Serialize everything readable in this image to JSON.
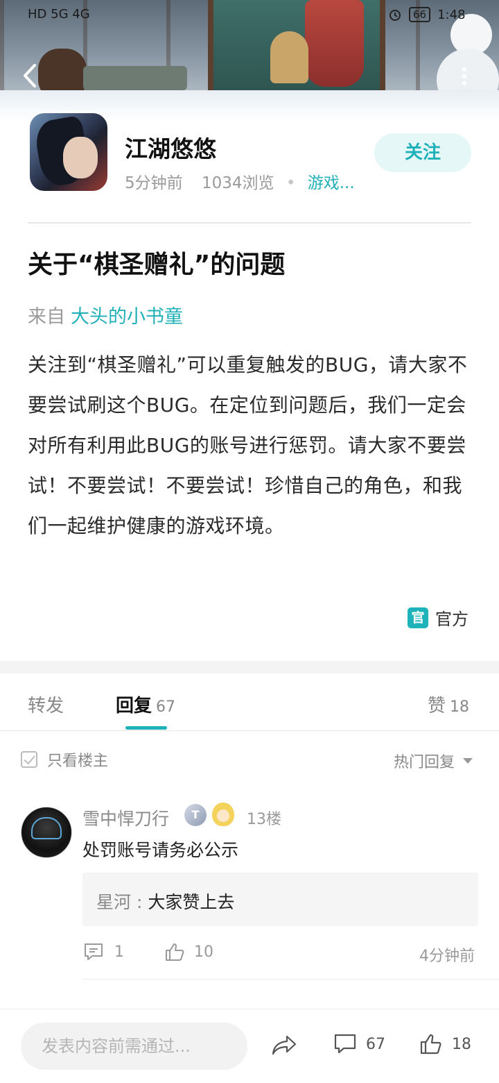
{
  "status_bar": {
    "left": "HD 5G 4G",
    "battery": "66",
    "time": "1:48"
  },
  "post": {
    "author": "江湖悠悠",
    "time_ago": "5分钟前",
    "views": "1034浏览",
    "category": "游戏...",
    "follow_label": "关注",
    "title": "关于“棋圣赠礼”的问题",
    "from_label": "来自",
    "from_source": "大头的小书童",
    "body": "关注到“棋圣赠礼”可以重复触发的BUG，请大家不要尝试刷这个BUG。在定位到问题后，我们一定会对所有利用此BUG的账号进行惩罚。请大家不要尝试！不要尝试！不要尝试！珍惜自己的角色，和我们一起维护健康的游戏环境。",
    "official_badge": "官",
    "official_label": "官方"
  },
  "tabs": {
    "forward": "转发",
    "reply": "回复",
    "reply_count": "67",
    "like": "赞",
    "like_count": "18"
  },
  "filters": {
    "only_op": "只看楼主",
    "sort": "热门回复"
  },
  "comments": [
    {
      "name": "雪中悍刀行",
      "level_badge": "T",
      "floor": "13楼",
      "text": "处罚账号请务必公示",
      "reply_name": "星河 : ",
      "reply_text": "大家赞上去",
      "reply_count": "1",
      "like_count": "10",
      "time": "4分钟前"
    }
  ],
  "bottom_bar": {
    "composer_placeholder": "发表内容前需通过...",
    "comment_count": "67",
    "like_count": "18"
  },
  "colors": {
    "accent": "#1eb3bb",
    "follow_bg": "#e6f7f8"
  }
}
